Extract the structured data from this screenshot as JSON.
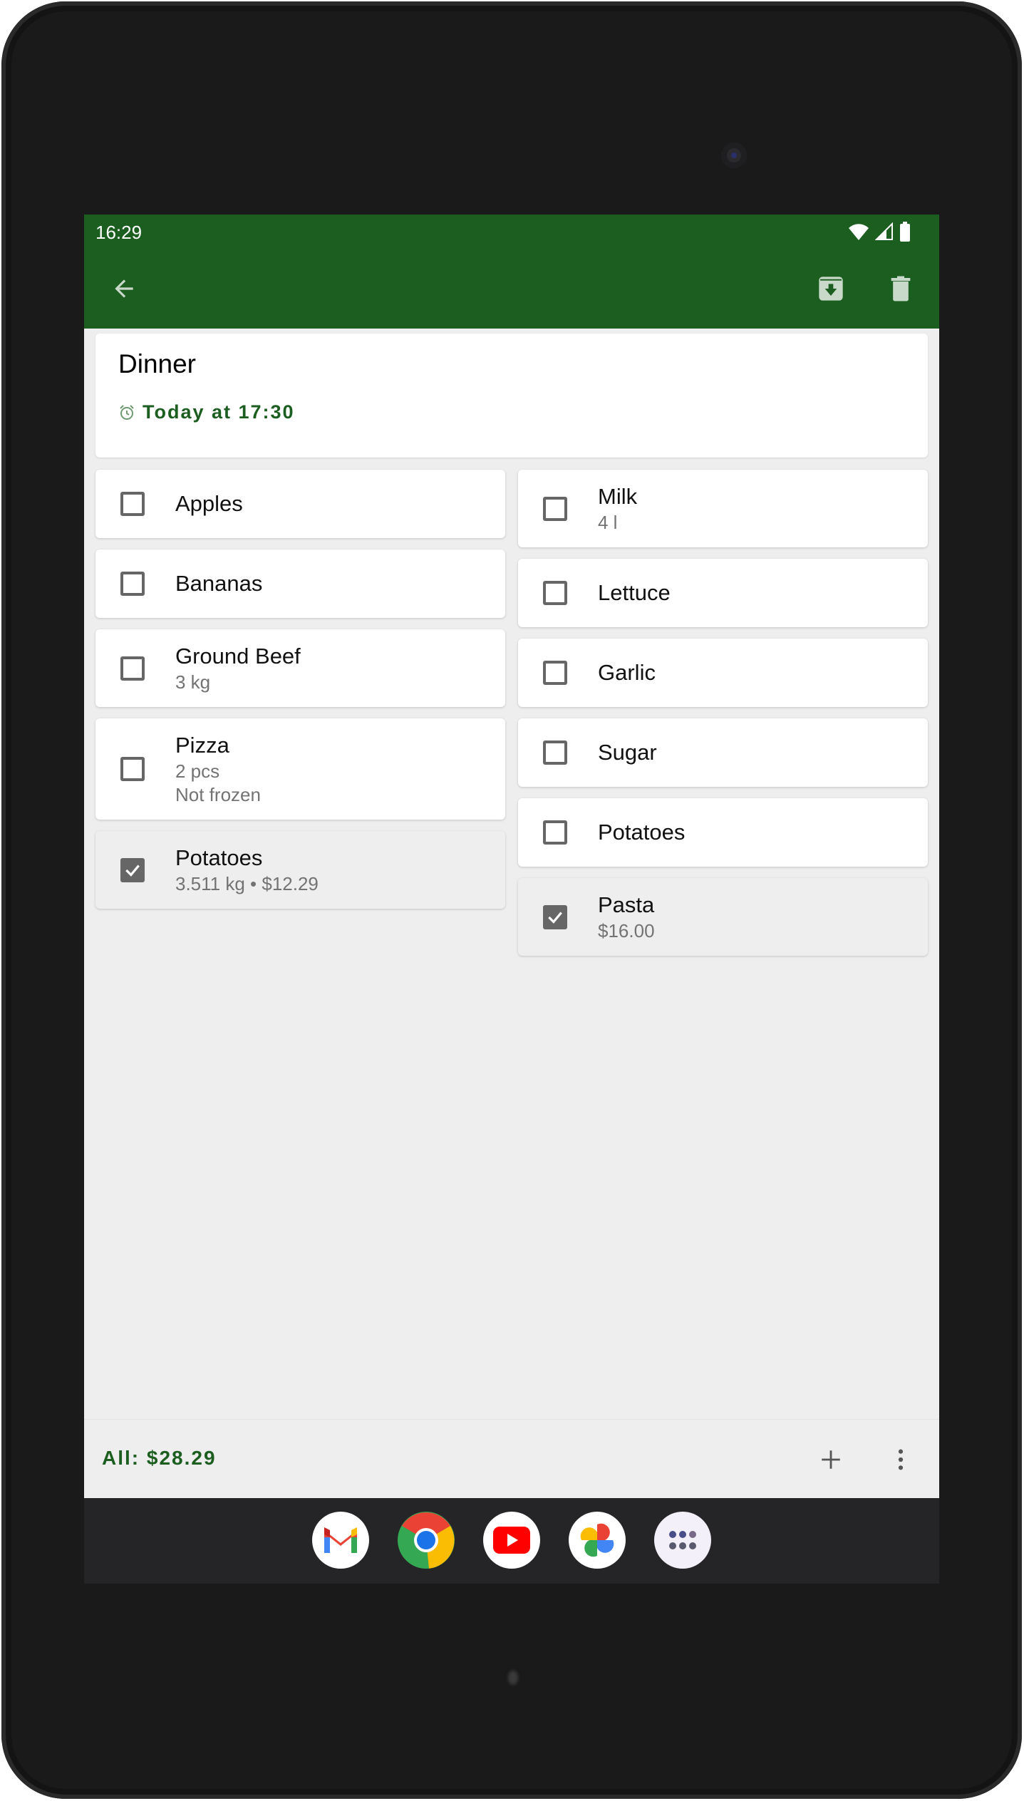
{
  "status_bar": {
    "time": "16:29",
    "icons": [
      "wifi-icon",
      "cell-signal-icon",
      "battery-icon"
    ]
  },
  "toolbar": {
    "back_icon": "arrow-left-icon",
    "actions": [
      {
        "name": "archive",
        "icon": "archive-icon"
      },
      {
        "name": "delete",
        "icon": "trash-icon"
      }
    ]
  },
  "list": {
    "title": "Dinner",
    "reminder_icon": "alarm-clock-icon",
    "reminder": "Today at 17:30"
  },
  "items_left": [
    {
      "name": "Apples",
      "details": [],
      "checked": false
    },
    {
      "name": "Bananas",
      "details": [],
      "checked": false
    },
    {
      "name": "Ground Beef",
      "details": [
        "3 kg"
      ],
      "checked": false
    },
    {
      "name": "Pizza",
      "details": [
        "2 pcs",
        "Not frozen"
      ],
      "checked": false
    },
    {
      "name": "Potatoes",
      "details": [
        "3.511 kg • $12.29"
      ],
      "checked": true
    }
  ],
  "items_right": [
    {
      "name": "Milk",
      "details": [
        "4 l"
      ],
      "checked": false
    },
    {
      "name": "Lettuce",
      "details": [],
      "checked": false
    },
    {
      "name": "Garlic",
      "details": [],
      "checked": false
    },
    {
      "name": "Sugar",
      "details": [],
      "checked": false
    },
    {
      "name": "Potatoes",
      "details": [],
      "checked": false
    },
    {
      "name": "Pasta",
      "details": [
        "$16.00"
      ],
      "checked": true
    }
  ],
  "bottom_bar": {
    "total": "All: $28.29",
    "add_icon": "plus-icon",
    "menu_icon": "more-vertical-icon"
  },
  "dock": {
    "apps": [
      {
        "name": "Gmail",
        "icon": "gmail-icon"
      },
      {
        "name": "Chrome",
        "icon": "chrome-icon"
      },
      {
        "name": "YouTube",
        "icon": "youtube-icon"
      },
      {
        "name": "Photos",
        "icon": "photos-icon"
      },
      {
        "name": "App drawer",
        "icon": "app-drawer-icon"
      }
    ]
  },
  "colors": {
    "primary": "#1b5e20",
    "background": "#eeeeee",
    "checkbox": "#666666",
    "secondary_text": "#737373"
  }
}
